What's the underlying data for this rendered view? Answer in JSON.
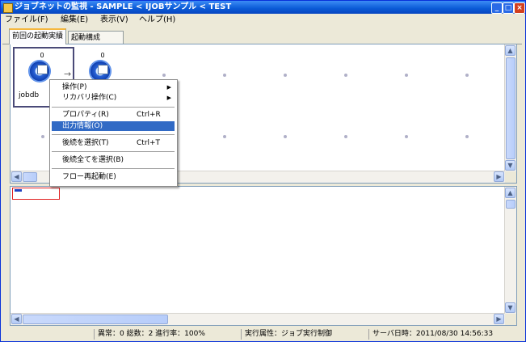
{
  "window": {
    "title": "ジョブネットの監視 - SAMPLE < IJOBサンプル < TEST",
    "buttons": {
      "minimize": "_",
      "maximize": "□",
      "close": "×"
    }
  },
  "menubar": [
    "ファイル(F)",
    "編集(E)",
    "表示(V)",
    "ヘルプ(H)"
  ],
  "tabs": [
    {
      "label": "前回の起動実績",
      "active": true
    },
    {
      "label": "起動構成",
      "active": false
    }
  ],
  "flow": {
    "jobs": [
      {
        "count": "0",
        "label": "jobdb"
      },
      {
        "count": "0",
        "label": ""
      }
    ]
  },
  "context_menu": {
    "items": [
      {
        "label": "操作(P)",
        "shortcut": "",
        "submenu": true,
        "highlighted": false
      },
      {
        "label": "リカバリ操作(C)",
        "shortcut": "",
        "submenu": true,
        "highlighted": false
      },
      {
        "label": "プロパティ(R)",
        "shortcut": "Ctrl+R",
        "submenu": false,
        "highlighted": false
      },
      {
        "label": "出力情報(O)",
        "shortcut": "",
        "submenu": false,
        "highlighted": true
      },
      {
        "label": "後続を選択(T)",
        "shortcut": "Ctrl+T",
        "submenu": false,
        "highlighted": false
      },
      {
        "label": "後続全てを選択(B)",
        "shortcut": "",
        "submenu": false,
        "highlighted": false
      },
      {
        "label": "フロー再起動(E)",
        "shortcut": "",
        "submenu": false,
        "highlighted": false
      }
    ]
  },
  "statusbar": {
    "summary": "異常：0 総数：2 進行率：100%",
    "exec_attr": "実行属性：ジョブ実行制御",
    "server_time": "サーバ日時：2011/08/30 14:56:33"
  },
  "icons": {
    "scroll_up": "▲",
    "scroll_down": "▼",
    "scroll_left": "◀",
    "scroll_right": "▶",
    "submenu_arrow": "▶"
  },
  "colors": {
    "highlight": "#316ac5",
    "titlebar": "#0a5ad6",
    "error_box": "#e02020"
  }
}
